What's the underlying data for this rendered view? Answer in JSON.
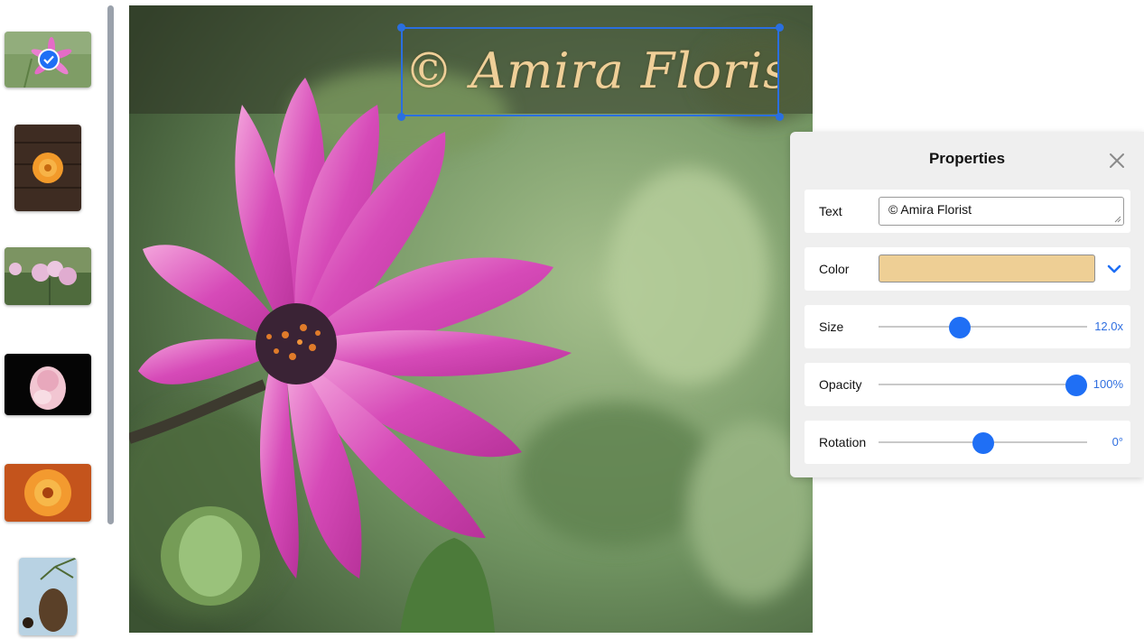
{
  "sidebar": {
    "thumbnails": [
      {
        "label": "Pink daisy",
        "selected": true
      },
      {
        "label": "Orange flower on wood",
        "selected": false
      },
      {
        "label": "Pink fluffy flowers",
        "selected": false
      },
      {
        "label": "Pink rose",
        "selected": false
      },
      {
        "label": "Orange flower",
        "selected": false
      },
      {
        "label": "Pine cone",
        "selected": false
      }
    ]
  },
  "canvas": {
    "watermark_text": "© Amira Florist",
    "watermark_color": "#efcf98",
    "selection_color": "#2a6fe0"
  },
  "panel": {
    "title": "Properties",
    "close_icon": "close-icon",
    "text": {
      "label": "Text",
      "value": "© Amira Florist"
    },
    "color": {
      "label": "Color",
      "swatch": "#eecf95",
      "dropdown_icon": "chevron-down-icon"
    },
    "size": {
      "label": "Size",
      "value": "12.0x",
      "level": 0.39
    },
    "opacity": {
      "label": "Opacity",
      "value": "100%",
      "level": 0.95
    },
    "rotation": {
      "label": "Rotation",
      "value": "0°",
      "level": 0.5
    }
  },
  "accent": "#1f6ff5"
}
